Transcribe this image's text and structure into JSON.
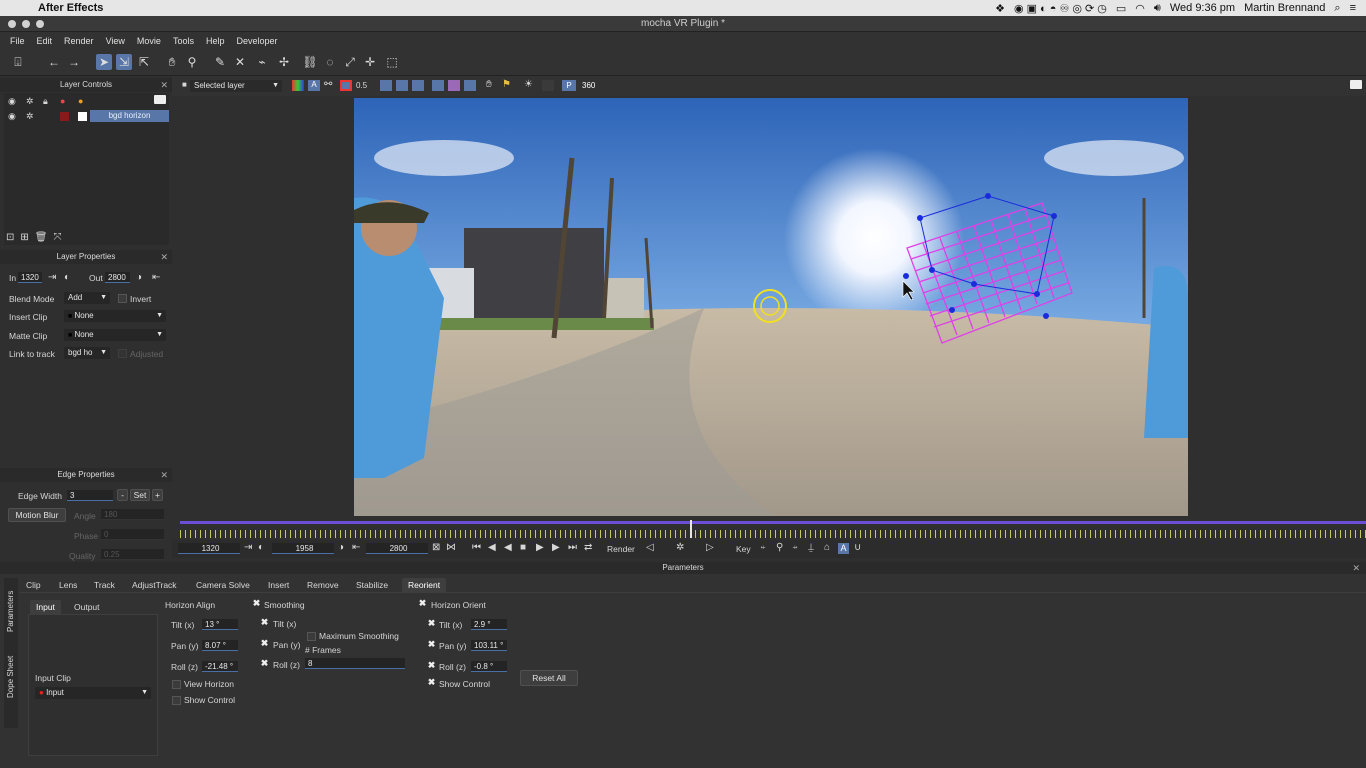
{
  "os_menubar": {
    "app_name": "After Effects",
    "clock": "Wed 9:36 pm",
    "user": "Martin Brennand"
  },
  "window": {
    "title": "mocha VR Plugin *"
  },
  "menu": [
    "File",
    "Edit",
    "Render",
    "View",
    "Movie",
    "Tools",
    "Help",
    "Developer"
  ],
  "layer_controls": {
    "title": "Layer Controls",
    "layer_name": "bgd horizon"
  },
  "layer_properties": {
    "title": "Layer Properties",
    "in_label": "In",
    "in_value": "1320",
    "out_label": "Out",
    "out_value": "2800",
    "blend_mode_label": "Blend Mode",
    "blend_mode_value": "Add",
    "invert_label": "Invert",
    "insert_clip_label": "Insert Clip",
    "insert_clip_value": "None",
    "matte_clip_label": "Matte Clip",
    "matte_clip_value": "None",
    "link_label": "Link to track",
    "link_value": "bgd ho",
    "adjusted_label": "Adjusted"
  },
  "edge_properties": {
    "title": "Edge Properties",
    "edge_width_label": "Edge Width",
    "edge_width_value": "3",
    "minus": "-",
    "set": "Set",
    "plus": "+",
    "motion_blur": "Motion Blur",
    "angle_label": "Angle",
    "angle_value": "180",
    "phase_label": "Phase",
    "phase_value": "0",
    "quality_label": "Quality",
    "quality_value": "0.25"
  },
  "viewer_toolbar": {
    "layer_select": "Selected layer",
    "opacity": "0.5",
    "p_label": "P",
    "degrees": "360"
  },
  "timeline": {
    "in_frame": "1320",
    "current_frame": "1958",
    "out_frame": "2800",
    "render_label": "Render",
    "key_label": "Key",
    "playhead_position": 0.43
  },
  "parameters": {
    "title": "Parameters",
    "tabs": [
      "Clip",
      "Lens",
      "Track",
      "AdjustTrack",
      "Camera Solve",
      "Insert",
      "Remove",
      "Stabilize",
      "Reorient"
    ],
    "active_tab": "Reorient",
    "side_tabs": [
      "Parameters",
      "Dope Sheet"
    ],
    "sub_tabs": [
      "Input",
      "Output"
    ],
    "input_clip_label": "Input Clip",
    "input_clip_value": "Input",
    "horizon_align": {
      "title": "Horizon Align",
      "tilt_label": "Tilt (x)",
      "tilt": "13 °",
      "pan_label": "Pan (y)",
      "pan": "8.07 °",
      "roll_label": "Roll (z)",
      "roll": "-21.48 °",
      "view_horizon": "View Horizon",
      "show_control": "Show Control"
    },
    "smoothing": {
      "title": "Smoothing",
      "tilt_label": "Tilt (x)",
      "pan_label": "Pan (y)",
      "roll_label": "Roll (z)",
      "max_smoothing": "Maximum Smoothing",
      "frames_label": "# Frames",
      "frames_value": "8"
    },
    "horizon_orient": {
      "title": "Horizon Orient",
      "tilt_label": "Tilt (x)",
      "tilt": "2.9 °",
      "pan_label": "Pan (y)",
      "pan": "103.11 °",
      "roll_label": "Roll (z)",
      "roll": "-0.8 °",
      "show_control": "Show Control",
      "reset_all": "Reset All"
    }
  },
  "colors": {
    "accent": "#5876a8",
    "track_magenta": "#e040e8",
    "timeline_bar": "#6b4fd8"
  }
}
